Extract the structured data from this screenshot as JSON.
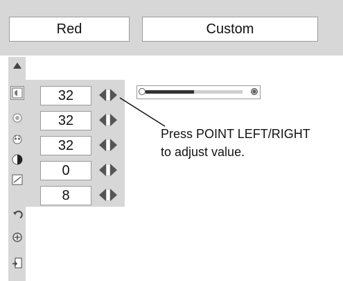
{
  "header": {
    "color_label": "Red",
    "mode_label": "Custom"
  },
  "sidebar": {
    "icons": [
      {
        "name": "up-arrow-icon"
      },
      {
        "name": "contrast-icon",
        "selected": true
      },
      {
        "name": "brightness-icon"
      },
      {
        "name": "color-temp-icon"
      },
      {
        "name": "tint-icon"
      },
      {
        "name": "sharpness-icon"
      },
      {
        "name": "reset-icon"
      },
      {
        "name": "store-icon"
      },
      {
        "name": "quit-icon"
      }
    ]
  },
  "adjustments": {
    "values": [
      "32",
      "32",
      "32",
      "0",
      "8"
    ]
  },
  "slider": {
    "level_fraction": 0.5
  },
  "callout": {
    "line1": "Press POINT LEFT/RIGHT",
    "line2": "to adjust value."
  },
  "colors": {
    "panel_gray": "#d7d7d7",
    "border_gray": "#9a9a9a"
  }
}
